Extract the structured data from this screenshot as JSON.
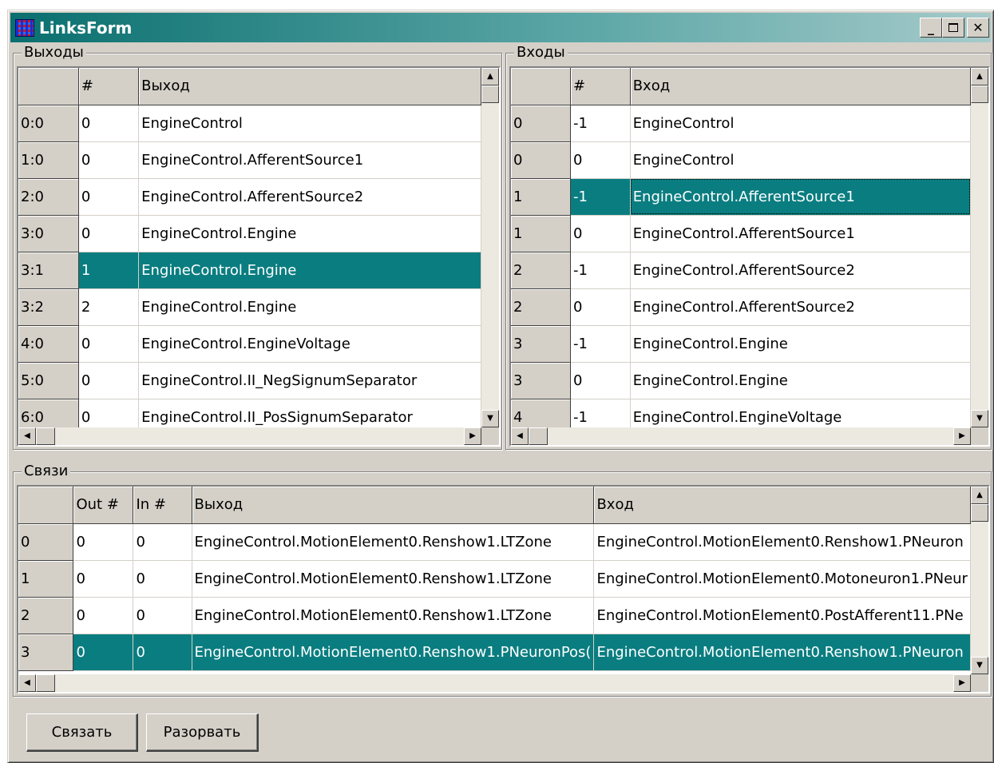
{
  "window": {
    "title": "LinksForm"
  },
  "outputs": {
    "title": "Выходы",
    "headers": [
      "",
      "#",
      "Выход"
    ],
    "rows": [
      [
        "0:0",
        "0",
        "EngineControl"
      ],
      [
        "1:0",
        "0",
        "EngineControl.AfferentSource1"
      ],
      [
        "2:0",
        "0",
        "EngineControl.AfferentSource2"
      ],
      [
        "3:0",
        "0",
        "EngineControl.Engine"
      ],
      [
        "3:1",
        "1",
        "EngineControl.Engine"
      ],
      [
        "3:2",
        "2",
        "EngineControl.Engine"
      ],
      [
        "4:0",
        "0",
        "EngineControl.EngineVoltage"
      ],
      [
        "5:0",
        "0",
        "EngineControl.II_NegSignumSeparator"
      ],
      [
        "6:0",
        "0",
        "EngineControl.II_PosSignumSeparator"
      ]
    ],
    "selected_row": 4
  },
  "inputs": {
    "title": "Входы",
    "headers": [
      "",
      "#",
      "Вход"
    ],
    "rows": [
      [
        "0",
        "-1",
        "EngineControl"
      ],
      [
        "0",
        "0",
        "EngineControl"
      ],
      [
        "1",
        "-1",
        "EngineControl.AfferentSource1"
      ],
      [
        "1",
        "0",
        "EngineControl.AfferentSource1"
      ],
      [
        "2",
        "-1",
        "EngineControl.AfferentSource2"
      ],
      [
        "2",
        "0",
        "EngineControl.AfferentSource2"
      ],
      [
        "3",
        "-1",
        "EngineControl.Engine"
      ],
      [
        "3",
        "0",
        "EngineControl.Engine"
      ],
      [
        "4",
        "-1",
        "EngineControl.EngineVoltage"
      ]
    ],
    "selected_row": 2
  },
  "links": {
    "title": "Связи",
    "headers": [
      "",
      "Out #",
      "In #",
      "Выход",
      "Вход"
    ],
    "rows": [
      [
        "0",
        "0",
        "0",
        "EngineControl.MotionElement0.Renshow1.LTZone",
        "EngineControl.MotionElement0.Renshow1.PNeuron"
      ],
      [
        "1",
        "0",
        "0",
        "EngineControl.MotionElement0.Renshow1.LTZone",
        "EngineControl.MotionElement0.Motoneuron1.PNeur"
      ],
      [
        "2",
        "0",
        "0",
        "EngineControl.MotionElement0.Renshow1.LTZone",
        "EngineControl.MotionElement0.PostAfferent11.PNe"
      ],
      [
        "3",
        "0",
        "0",
        "EngineControl.MotionElement0.Renshow1.PNeuronPos(",
        "EngineControl.MotionElement0.Renshow1.PNeuron"
      ]
    ],
    "selected_row": 3
  },
  "buttons": {
    "connect": "Связать",
    "disconnect": "Разорвать"
  },
  "colors": {
    "selection": "#0a7d80",
    "face": "#d4d0c8"
  }
}
